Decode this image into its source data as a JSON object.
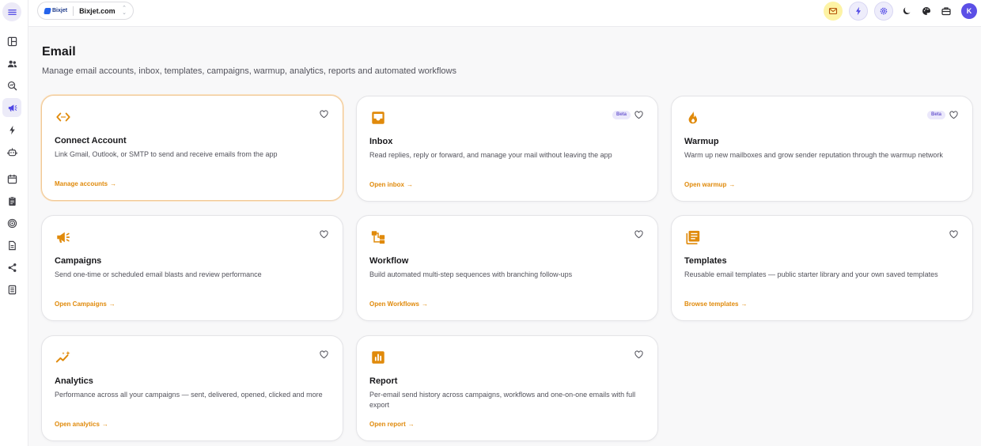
{
  "header": {
    "workspace_logo": "Bixjet",
    "workspace_name": "Bixjet.com",
    "avatar_initial": "K"
  },
  "page": {
    "title": "Email",
    "subtitle": "Manage email accounts, inbox, templates, campaigns, warmup, analytics, reports and automated workflows"
  },
  "colors": {
    "accent": "#e08a0b",
    "brand": "#5b4fe6",
    "beta_bg": "#ebe8fb"
  },
  "cards": [
    {
      "title": "Connect Account",
      "description": "Link Gmail, Outlook, or SMTP to send and receive emails from the app",
      "link": "Manage accounts",
      "icon": "code-link-icon",
      "beta": ""
    },
    {
      "title": "Inbox",
      "description": "Read replies, reply or forward, and manage your mail without leaving the app",
      "link": "Open inbox",
      "icon": "inbox-icon",
      "beta": "Beta"
    },
    {
      "title": "Warmup",
      "description": "Warm up new mailboxes and grow sender reputation through the warmup network",
      "link": "Open warmup",
      "icon": "fire-icon",
      "beta": "Beta"
    },
    {
      "title": "Campaigns",
      "description": "Send one-time or scheduled email blasts and review performance",
      "link": "Open Campaigns",
      "icon": "megaphone-icon",
      "beta": ""
    },
    {
      "title": "Workflow",
      "description": "Build automated multi-step sequences with branching follow-ups",
      "link": "Open Workflows",
      "icon": "workflow-icon",
      "beta": ""
    },
    {
      "title": "Templates",
      "description": "Reusable email templates — public starter library and your own saved templates",
      "link": "Browse templates",
      "icon": "templates-icon",
      "beta": ""
    },
    {
      "title": "Analytics",
      "description": "Performance across all your campaigns — sent, delivered, opened, clicked and more",
      "link": "Open analytics",
      "icon": "analytics-icon",
      "beta": ""
    },
    {
      "title": "Report",
      "description": "Per-email send history across campaigns, workflows and one-on-one emails with full export",
      "link": "Open report",
      "icon": "report-icon",
      "beta": ""
    }
  ]
}
